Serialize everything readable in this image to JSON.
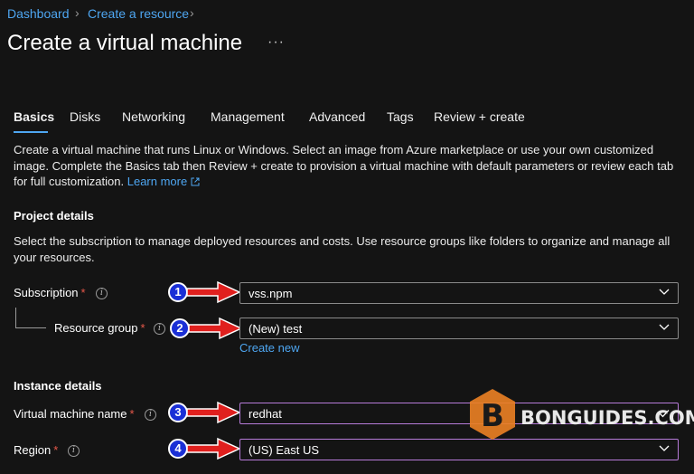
{
  "breadcrumb": {
    "items": [
      "Dashboard",
      "Create a resource"
    ]
  },
  "page": {
    "title": "Create a virtual machine",
    "more": "···"
  },
  "tabs": [
    {
      "label": "Basics",
      "active": true
    },
    {
      "label": "Disks"
    },
    {
      "label": "Networking"
    },
    {
      "label": "Management"
    },
    {
      "label": "Advanced"
    },
    {
      "label": "Tags"
    },
    {
      "label": "Review + create"
    }
  ],
  "intro": {
    "line1": "Create a virtual machine that runs Linux or Windows. Select an image from Azure marketplace or use your own customized",
    "line2": "image. Complete the Basics tab then Review + create to provision a virtual machine with default parameters or review each tab",
    "line3": "for full customization.",
    "learn_more": "Learn more"
  },
  "project": {
    "heading": "Project details",
    "desc1": "Select the subscription to manage deployed resources and costs. Use resource groups like folders to organize and manage all",
    "desc2": "your resources.",
    "subscription": {
      "label": "Subscription",
      "required": "*",
      "value": "vss.npm"
    },
    "resource_group": {
      "label": "Resource group",
      "required": "*",
      "value": "(New) test",
      "create_new": "Create new"
    }
  },
  "instance": {
    "heading": "Instance details",
    "vm_name": {
      "label": "Virtual machine name",
      "required": "*",
      "value": "redhat"
    },
    "region": {
      "label": "Region",
      "required": "*",
      "value": "(US) East US"
    }
  },
  "annotations": [
    "1",
    "2",
    "3",
    "4"
  ],
  "watermark": {
    "letter": "B",
    "text": "BONGUIDES.COM"
  },
  "colors": {
    "link": "#4ea6f1",
    "required": "#e8584a",
    "badge": "#1a2fd6",
    "arrow": "#e0201e",
    "focus_border": "#b77bd9",
    "watermark_hex": "#e87f24"
  }
}
